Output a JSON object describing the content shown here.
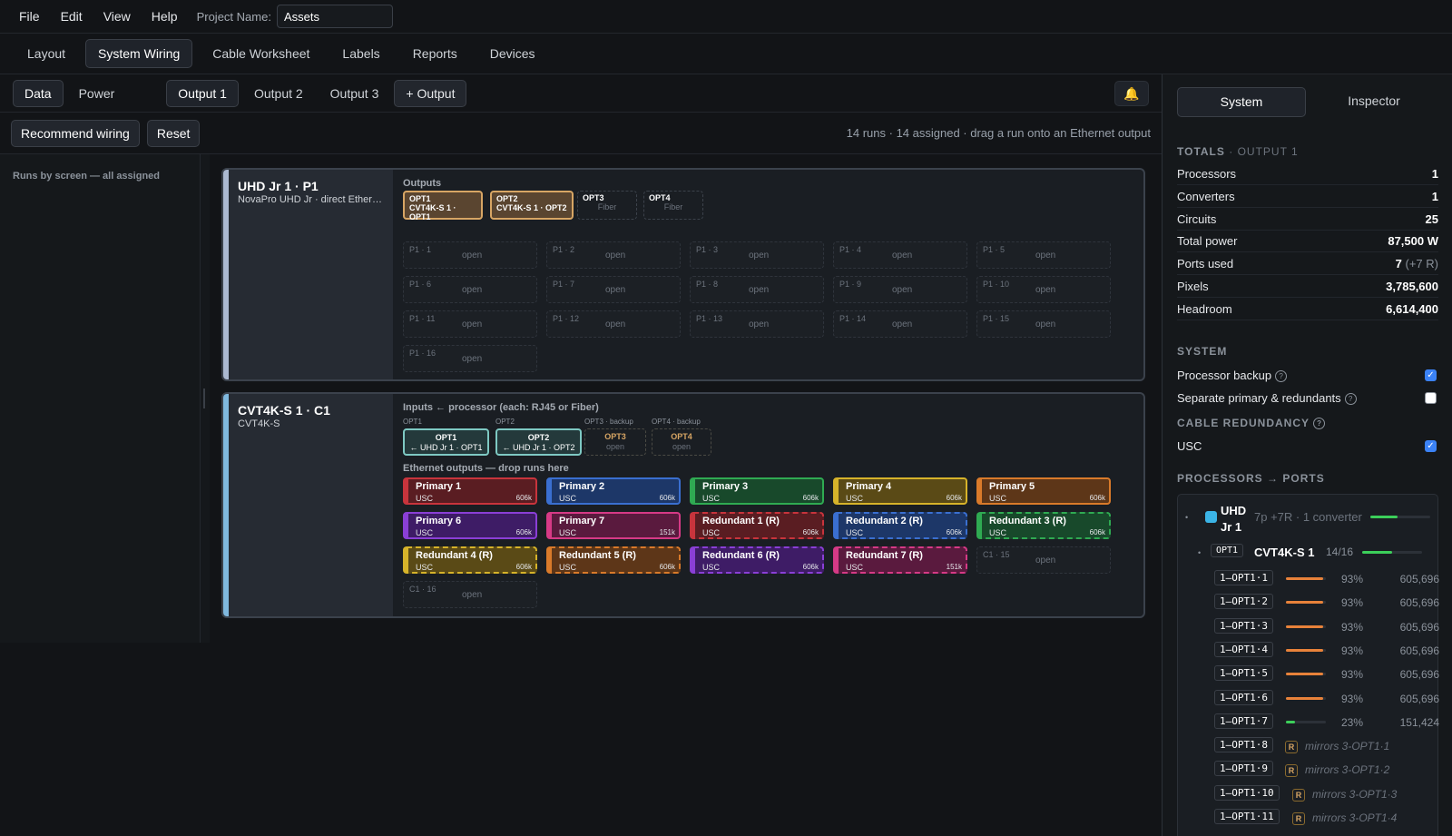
{
  "menubar": {
    "items": [
      "File",
      "Edit",
      "View",
      "Help"
    ],
    "project_label": "Project Name:",
    "project_value": "Assets"
  },
  "tabs": [
    "Layout",
    "System Wiring",
    "Cable Worksheet",
    "Labels",
    "Reports",
    "Devices"
  ],
  "active_tab": "System Wiring",
  "subbar": {
    "modes": [
      "Data",
      "Power"
    ],
    "outputs": [
      "Output 1",
      "Output 2",
      "Output 3"
    ],
    "add_output": "+ Output"
  },
  "actions": {
    "recommend": "Recommend wiring",
    "reset": "Reset",
    "summary": "14 runs · 14 assigned · drag a run onto an Ethernet output"
  },
  "left_rail": {
    "title": "Runs by screen — all assigned"
  },
  "processor_card": {
    "name": "UHD Jr 1  ·  P1",
    "subtitle": "NovaPro UHD Jr · direct Ethernet",
    "outputs_title": "Outputs",
    "outputs": [
      {
        "label": "OPT1",
        "detail": "CVT4K-S 1 · OPT1",
        "state": "used"
      },
      {
        "label": "OPT2",
        "detail": "CVT4K-S 1 · OPT2",
        "state": "used"
      },
      {
        "label": "OPT3",
        "detail": "Fiber",
        "state": "free"
      },
      {
        "label": "OPT4",
        "detail": "Fiber",
        "state": "free"
      }
    ],
    "open_label": "open",
    "slots": [
      "P1 · 1",
      "P1 · 2",
      "P1 · 3",
      "P1 · 4",
      "P1 · 5",
      "P1 · 6",
      "P1 · 7",
      "P1 · 8",
      "P1 · 9",
      "P1 · 10",
      "P1 · 11",
      "P1 · 12",
      "P1 · 13",
      "P1 · 14",
      "P1 · 15",
      "P1 · 16"
    ]
  },
  "converter_card": {
    "name": "CVT4K-S 1  ·  C1",
    "subtitle": "CVT4K-S",
    "inputs_title": "Inputs ← processor (each: RJ45 or Fiber)",
    "inputs": [
      {
        "label": "OPT1",
        "name": "OPT1",
        "detail": "← UHD Jr 1 · OPT1",
        "state": "used"
      },
      {
        "label": "OPT2",
        "name": "OPT2",
        "detail": "← UHD Jr 1 · OPT2",
        "state": "used"
      },
      {
        "label": "OPT3 · backup",
        "name": "OPT3",
        "detail": "open",
        "state": "free"
      },
      {
        "label": "OPT4 · backup",
        "name": "OPT4",
        "detail": "open",
        "state": "free"
      }
    ],
    "eth_title": "Ethernet outputs — drop runs here",
    "runs": [
      {
        "name": "Primary 1",
        "type": "USC",
        "load": "606k",
        "color": "red",
        "redundant": false
      },
      {
        "name": "Primary 2",
        "type": "USC",
        "load": "606k",
        "color": "blue",
        "redundant": false
      },
      {
        "name": "Primary 3",
        "type": "USC",
        "load": "606k",
        "color": "green",
        "redundant": false
      },
      {
        "name": "Primary 4",
        "type": "USC",
        "load": "606k",
        "color": "yellow",
        "redundant": false
      },
      {
        "name": "Primary 5",
        "type": "USC",
        "load": "606k",
        "color": "orange",
        "redundant": false
      },
      {
        "name": "Primary 6",
        "type": "USC",
        "load": "606k",
        "color": "purple",
        "redundant": false
      },
      {
        "name": "Primary 7",
        "type": "USC",
        "load": "151k",
        "color": "pink",
        "redundant": false
      },
      {
        "name": "Redundant 1 (R)",
        "type": "USC",
        "load": "606k",
        "color": "red",
        "redundant": true
      },
      {
        "name": "Redundant 2 (R)",
        "type": "USC",
        "load": "606k",
        "color": "blue",
        "redundant": true
      },
      {
        "name": "Redundant 3 (R)",
        "type": "USC",
        "load": "606k",
        "color": "green",
        "redundant": true
      },
      {
        "name": "Redundant 4 (R)",
        "type": "USC",
        "load": "606k",
        "color": "yellow",
        "redundant": true
      },
      {
        "name": "Redundant 5 (R)",
        "type": "USC",
        "load": "606k",
        "color": "orange",
        "redundant": true
      },
      {
        "name": "Redundant 6 (R)",
        "type": "USC",
        "load": "606k",
        "color": "purple",
        "redundant": true
      },
      {
        "name": "Redundant 7 (R)",
        "type": "USC",
        "load": "151k",
        "color": "pink",
        "redundant": true
      }
    ],
    "open_slots": [
      "C1 · 15",
      "C1 · 16"
    ],
    "open_label": "open"
  },
  "right_panel": {
    "tabs": [
      "System",
      "Inspector"
    ],
    "totals_title": "TOTALS",
    "totals_scope": "· OUTPUT 1",
    "totals": [
      {
        "label": "Processors",
        "value": "1",
        "extra": ""
      },
      {
        "label": "Converters",
        "value": "1",
        "extra": ""
      },
      {
        "label": "Circuits",
        "value": "25",
        "extra": ""
      },
      {
        "label": "Total power",
        "value": "87,500 W",
        "extra": ""
      },
      {
        "label": "Ports used",
        "value": "7",
        "extra": "(+7 R)"
      },
      {
        "label": "Pixels",
        "value": "3,785,600",
        "extra": ""
      },
      {
        "label": "Headroom",
        "value": "6,614,400",
        "extra": ""
      }
    ],
    "system_title": "SYSTEM",
    "processor_backup": "Processor backup",
    "separate": "Separate primary & redundants",
    "cable_red_title": "CABLE REDUNDANCY",
    "usc": "USC",
    "checks": {
      "processor_backup": true,
      "separate": false,
      "usc": true
    },
    "ports_title": "PROCESSORS → PORTS",
    "processor": {
      "name": "UHD Jr 1",
      "info": "7p +7R · 1 converter",
      "fill": 0.45
    },
    "converter": {
      "port": "OPT1",
      "name": "CVT4K-S 1",
      "count": "14/16",
      "fill": 0.5
    },
    "ports": [
      {
        "id": "1–OPT1·1",
        "pct": "93%",
        "val": "605,696",
        "fill": 0.93,
        "mirror": ""
      },
      {
        "id": "1–OPT1·2",
        "pct": "93%",
        "val": "605,696",
        "fill": 0.93,
        "mirror": ""
      },
      {
        "id": "1–OPT1·3",
        "pct": "93%",
        "val": "605,696",
        "fill": 0.93,
        "mirror": ""
      },
      {
        "id": "1–OPT1·4",
        "pct": "93%",
        "val": "605,696",
        "fill": 0.93,
        "mirror": ""
      },
      {
        "id": "1–OPT1·5",
        "pct": "93%",
        "val": "605,696",
        "fill": 0.93,
        "mirror": ""
      },
      {
        "id": "1–OPT1·6",
        "pct": "93%",
        "val": "605,696",
        "fill": 0.93,
        "mirror": ""
      },
      {
        "id": "1–OPT1·7",
        "pct": "23%",
        "val": "151,424",
        "fill": 0.23,
        "mirror": ""
      },
      {
        "id": "1–OPT1·8",
        "pct": "",
        "val": "",
        "fill": 0,
        "mirror": "mirrors 3-OPT1·1"
      },
      {
        "id": "1–OPT1·9",
        "pct": "",
        "val": "",
        "fill": 0,
        "mirror": "mirrors 3-OPT1·2"
      },
      {
        "id": "1–OPT1·10",
        "pct": "",
        "val": "",
        "fill": 0,
        "mirror": "mirrors 3-OPT1·3"
      },
      {
        "id": "1–OPT1·11",
        "pct": "",
        "val": "",
        "fill": 0,
        "mirror": "mirrors 3-OPT1·4"
      }
    ],
    "redundant_badge": "R",
    "colors": {
      "orange_bar": "#e8823a",
      "green_bar": "#3ccf5a",
      "processor_swatch": "#3bb4e6",
      "accent": "#3b82f6"
    }
  }
}
